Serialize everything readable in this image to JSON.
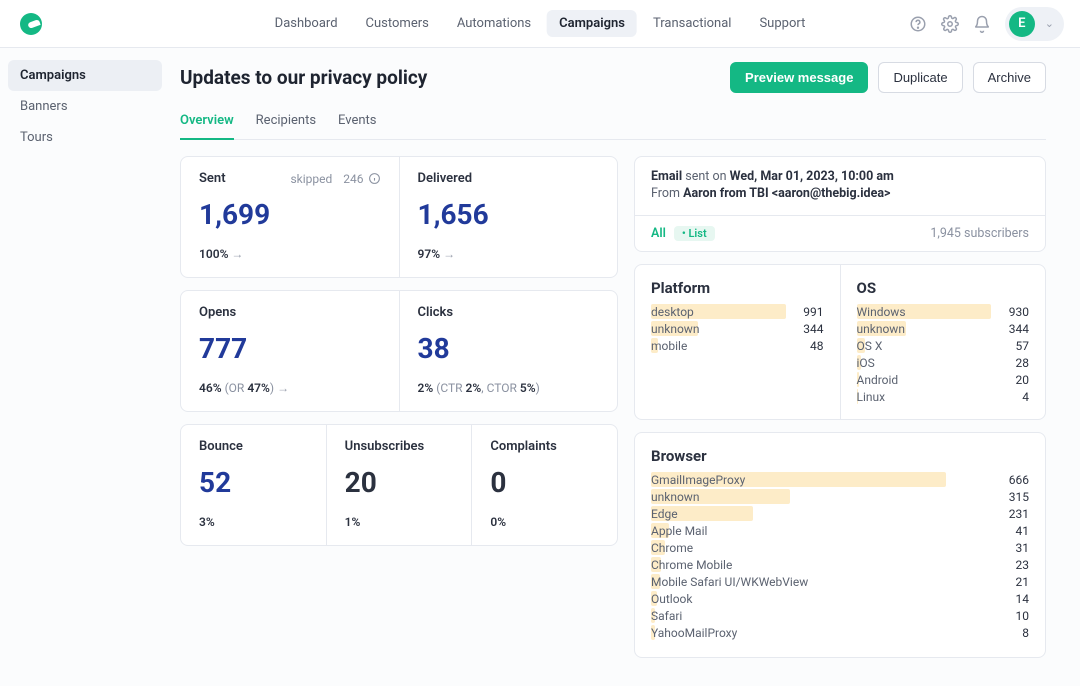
{
  "nav": {
    "items": [
      "Dashboard",
      "Customers",
      "Automations",
      "Campaigns",
      "Transactional",
      "Support"
    ],
    "active_index": 3
  },
  "avatar_initial": "E",
  "sidebar": {
    "items": [
      "Campaigns",
      "Banners",
      "Tours"
    ],
    "active_index": 0
  },
  "page_title": "Updates to our privacy policy",
  "buttons": {
    "preview": "Preview message",
    "duplicate": "Duplicate",
    "archive": "Archive"
  },
  "tabs": {
    "items": [
      "Overview",
      "Recipients",
      "Events"
    ],
    "active_index": 0
  },
  "sent": {
    "label": "Sent",
    "value": "1,699",
    "pct": "100%",
    "skipped_label": "skipped",
    "skipped_value": "246"
  },
  "delivered": {
    "label": "Delivered",
    "value": "1,656",
    "pct": "97%"
  },
  "opens": {
    "label": "Opens",
    "value": "777",
    "pct": "46%",
    "or_label": "OR",
    "or_pct": "47%"
  },
  "clicks": {
    "label": "Clicks",
    "value": "38",
    "pct": "2%",
    "ctr_label": "CTR",
    "ctr_pct": "2%",
    "ctor_label": "CTOR",
    "ctor_pct": "5%"
  },
  "bounce": {
    "label": "Bounce",
    "value": "52",
    "pct": "3%"
  },
  "unsub": {
    "label": "Unsubscribes",
    "value": "20",
    "pct": "1%"
  },
  "complaints": {
    "label": "Complaints",
    "value": "0",
    "pct": "0%"
  },
  "send_info": {
    "channel": "Email",
    "sent_on_label": "sent on",
    "sent_on": "Wed, Mar 01, 2023, 10:00 am",
    "from_label": "From",
    "from": "Aaron from TBI <aaron@thebig.idea>",
    "all_label": "All",
    "list_pill": "List",
    "subscribers": "1,945 subscribers"
  },
  "platform": {
    "title": "Platform",
    "rows": [
      {
        "name": "desktop",
        "value": 991
      },
      {
        "name": "unknown",
        "value": 344
      },
      {
        "name": "mobile",
        "value": 48
      }
    ],
    "max": 991
  },
  "os": {
    "title": "OS",
    "rows": [
      {
        "name": "Windows",
        "value": 930
      },
      {
        "name": "unknown",
        "value": 344
      },
      {
        "name": "OS X",
        "value": 57
      },
      {
        "name": "iOS",
        "value": 28
      },
      {
        "name": "Android",
        "value": 20
      },
      {
        "name": "Linux",
        "value": 4
      }
    ],
    "max": 930
  },
  "browser": {
    "title": "Browser",
    "rows": [
      {
        "name": "GmailImageProxy",
        "value": 666
      },
      {
        "name": "unknown",
        "value": 315
      },
      {
        "name": "Edge",
        "value": 231
      },
      {
        "name": "Apple Mail",
        "value": 41
      },
      {
        "name": "Chrome",
        "value": 31
      },
      {
        "name": "Chrome Mobile",
        "value": 23
      },
      {
        "name": "Mobile Safari UI/WKWebView",
        "value": 21
      },
      {
        "name": "Outlook",
        "value": 14
      },
      {
        "name": "Safari",
        "value": 10
      },
      {
        "name": "YahooMailProxy",
        "value": 8
      }
    ],
    "max": 666
  },
  "chart_data": [
    {
      "type": "bar",
      "title": "Platform",
      "categories": [
        "desktop",
        "unknown",
        "mobile"
      ],
      "values": [
        991,
        344,
        48
      ]
    },
    {
      "type": "bar",
      "title": "OS",
      "categories": [
        "Windows",
        "unknown",
        "OS X",
        "iOS",
        "Android",
        "Linux"
      ],
      "values": [
        930,
        344,
        57,
        28,
        20,
        4
      ]
    },
    {
      "type": "bar",
      "title": "Browser",
      "categories": [
        "GmailImageProxy",
        "unknown",
        "Edge",
        "Apple Mail",
        "Chrome",
        "Chrome Mobile",
        "Mobile Safari UI/WKWebView",
        "Outlook",
        "Safari",
        "YahooMailProxy"
      ],
      "values": [
        666,
        315,
        231,
        41,
        31,
        23,
        21,
        14,
        10,
        8
      ]
    }
  ]
}
